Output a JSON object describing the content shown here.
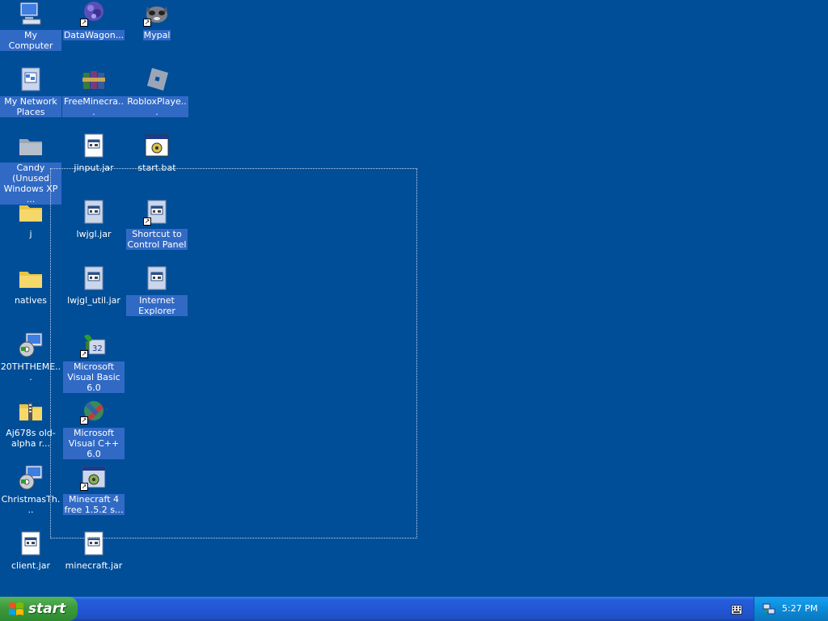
{
  "desktop": {
    "icons": [
      {
        "label": "My Computer",
        "icon": "my-computer-icon"
      },
      {
        "label": "DataWagon...",
        "icon": "datawagon-icon"
      },
      {
        "label": "Mypal",
        "icon": "mypal-icon"
      },
      {
        "label": "My Network Places",
        "icon": "network-places-icon"
      },
      {
        "label": "FreeMinecra...",
        "icon": "winrar-archive-icon"
      },
      {
        "label": "RobloxPlaye...",
        "icon": "roblox-icon"
      },
      {
        "label": "Candy (Unused Windows XP ...",
        "icon": "folder-icon"
      },
      {
        "label": "jinput.jar",
        "icon": "jar-file-icon"
      },
      {
        "label": "start.bat",
        "icon": "batch-file-icon"
      },
      {
        "label": "j",
        "icon": "folder-icon"
      },
      {
        "label": "lwjgl.jar",
        "icon": "jar-file-icon"
      },
      {
        "label": "Shortcut to Control Panel",
        "icon": "control-panel-shortcut-icon"
      },
      {
        "label": "natives",
        "icon": "folder-icon"
      },
      {
        "label": "lwjgl_util.jar",
        "icon": "jar-file-icon"
      },
      {
        "label": "Internet Explorer",
        "icon": "internet-explorer-icon"
      },
      {
        "label": "20THTHEME...",
        "icon": "installer-icon"
      },
      {
        "label": "Microsoft Visual Basic 6.0",
        "icon": "visual-basic-icon"
      },
      {
        "label": "Aj678s old-alpha r...",
        "icon": "zip-folder-icon"
      },
      {
        "label": "Microsoft Visual C++ 6.0",
        "icon": "visual-cpp-icon"
      },
      {
        "label": "ChristmasTh...",
        "icon": "installer-icon"
      },
      {
        "label": "Minecraft 4 free 1.5.2 s...",
        "icon": "minecraft-shortcut-icon"
      },
      {
        "label": "client.jar",
        "icon": "jar-file-icon"
      },
      {
        "label": "minecraft.jar",
        "icon": "jar-file-icon"
      }
    ]
  },
  "taskbar": {
    "start_label": "start",
    "clock": "5:27 PM"
  },
  "colors": {
    "desktop_background": "#004e98",
    "selection_highlight": "#316ac5",
    "taskbar_blue": "#245edb",
    "start_green": "#3c9a3c"
  }
}
